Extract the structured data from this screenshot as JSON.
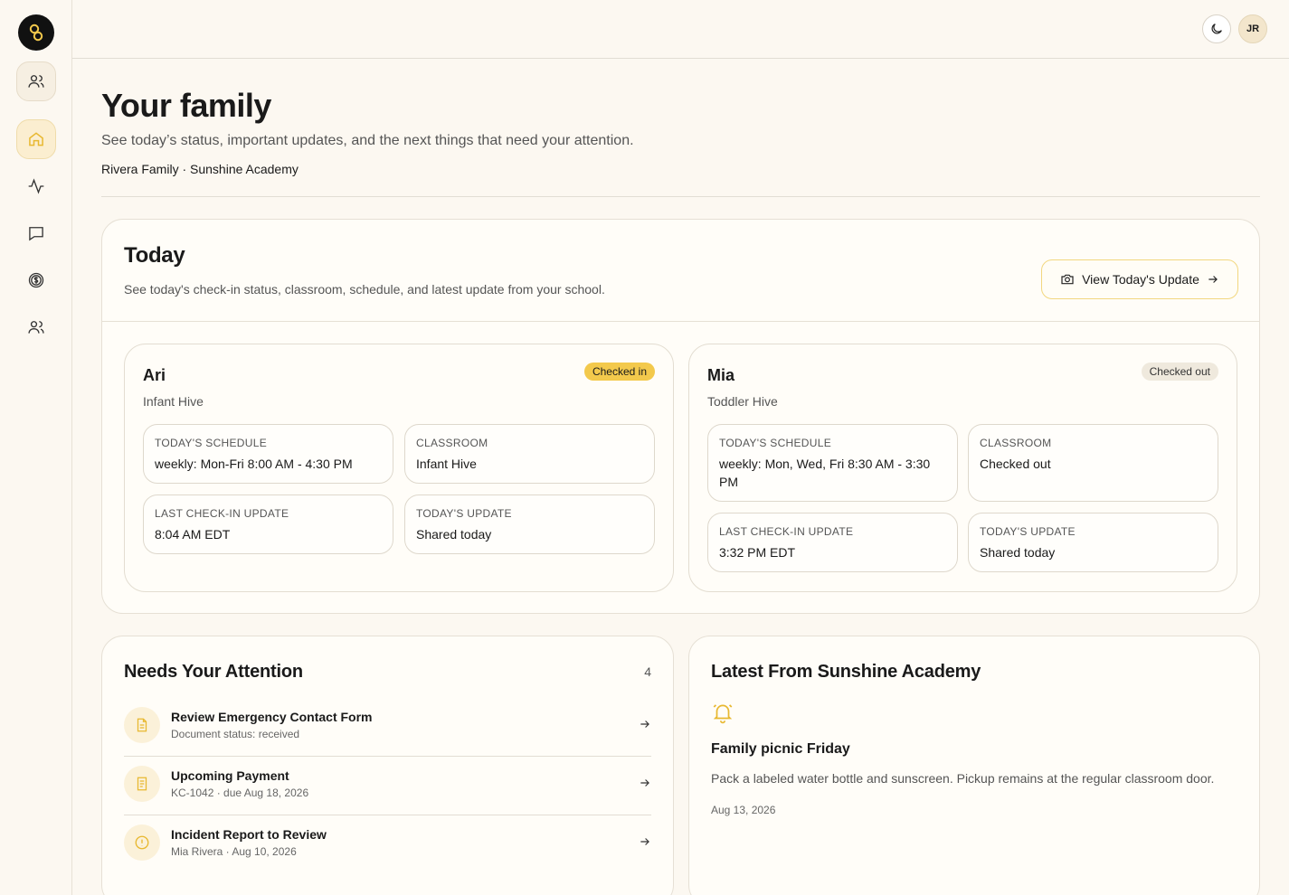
{
  "header": {
    "avatar_initials": "JR"
  },
  "sidebar": {
    "items": [
      {
        "icon": "users-icon"
      },
      {
        "icon": "home-icon",
        "active": true
      },
      {
        "icon": "activity-icon"
      },
      {
        "icon": "message-icon"
      },
      {
        "icon": "dollar-icon"
      },
      {
        "icon": "users-icon"
      }
    ]
  },
  "page": {
    "title": "Your family",
    "subtitle": "See today’s status, important updates, and the next things that need your attention.",
    "family_line": "Rivera Family · Sunshine Academy"
  },
  "today": {
    "title": "Today",
    "subtitle": "See today's check-in status, classroom, schedule, and latest update from your school.",
    "view_button": "View Today's Update",
    "children": [
      {
        "name": "Ari",
        "classroom_name": "Infant Hive",
        "status": "Checked in",
        "schedule_label": "TODAY'S SCHEDULE",
        "schedule": "weekly: Mon-Fri 8:00 AM - 4:30 PM",
        "classroom_label": "CLASSROOM",
        "classroom": "Infant Hive",
        "checkin_label": "LAST CHECK-IN UPDATE",
        "checkin": "8:04 AM EDT",
        "update_label": "TODAY'S UPDATE",
        "update": "Shared today"
      },
      {
        "name": "Mia",
        "classroom_name": "Toddler Hive",
        "status": "Checked out",
        "schedule_label": "TODAY'S SCHEDULE",
        "schedule": "weekly: Mon, Wed, Fri 8:30 AM - 3:30 PM",
        "classroom_label": "CLASSROOM",
        "classroom": "Checked out",
        "checkin_label": "LAST CHECK-IN UPDATE",
        "checkin": "3:32 PM EDT",
        "update_label": "TODAY'S UPDATE",
        "update": "Shared today"
      }
    ]
  },
  "attention": {
    "title": "Needs Your Attention",
    "count": "4",
    "items": [
      {
        "title": "Review Emergency Contact Form",
        "meta": "Document status: received",
        "icon": "document-icon"
      },
      {
        "title": "Upcoming Payment",
        "meta": "KC-1042 · due Aug 18, 2026",
        "icon": "receipt-icon"
      },
      {
        "title": "Incident Report to Review",
        "meta": "Mia Rivera · Aug 10, 2026",
        "icon": "alert-circle-icon"
      }
    ]
  },
  "latest": {
    "title": "Latest From Sunshine Academy",
    "item_title": "Family picnic Friday",
    "item_body": "Pack a labeled water bottle and sunscreen. Pickup remains at the regular classroom door.",
    "item_date": "Aug 13, 2026"
  },
  "colors": {
    "accent": "#f3c94c",
    "background": "#fcf8f1",
    "icon_accent": "#e8b830"
  }
}
